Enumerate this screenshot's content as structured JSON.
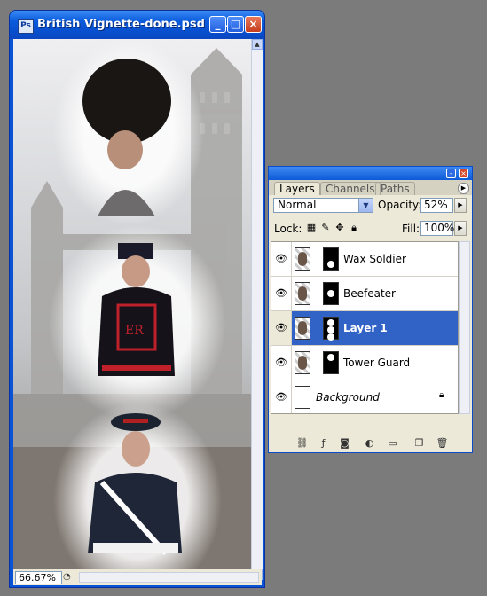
{
  "document": {
    "title": "British Vignette-done.psd @...",
    "zoom": "66.67%"
  },
  "layers_panel": {
    "tabs": [
      "Layers",
      "Channels",
      "Paths"
    ],
    "blend_mode": "Normal",
    "opacity_label": "Opacity:",
    "opacity_value": "52%",
    "lock_label": "Lock:",
    "fill_label": "Fill:",
    "fill_value": "100%",
    "layers": [
      {
        "name": "Wax Soldier",
        "selected": false
      },
      {
        "name": "Beefeater",
        "selected": false
      },
      {
        "name": "Layer 1",
        "selected": true
      },
      {
        "name": "Tower Guard",
        "selected": false
      },
      {
        "name": "Background",
        "selected": false,
        "locked": true
      }
    ]
  },
  "colors": {
    "title_bar": "#0a52d6",
    "selected_layer": "#3163c6",
    "panel_bg": "#ece9d8",
    "desktop": "#7b7b7b"
  }
}
